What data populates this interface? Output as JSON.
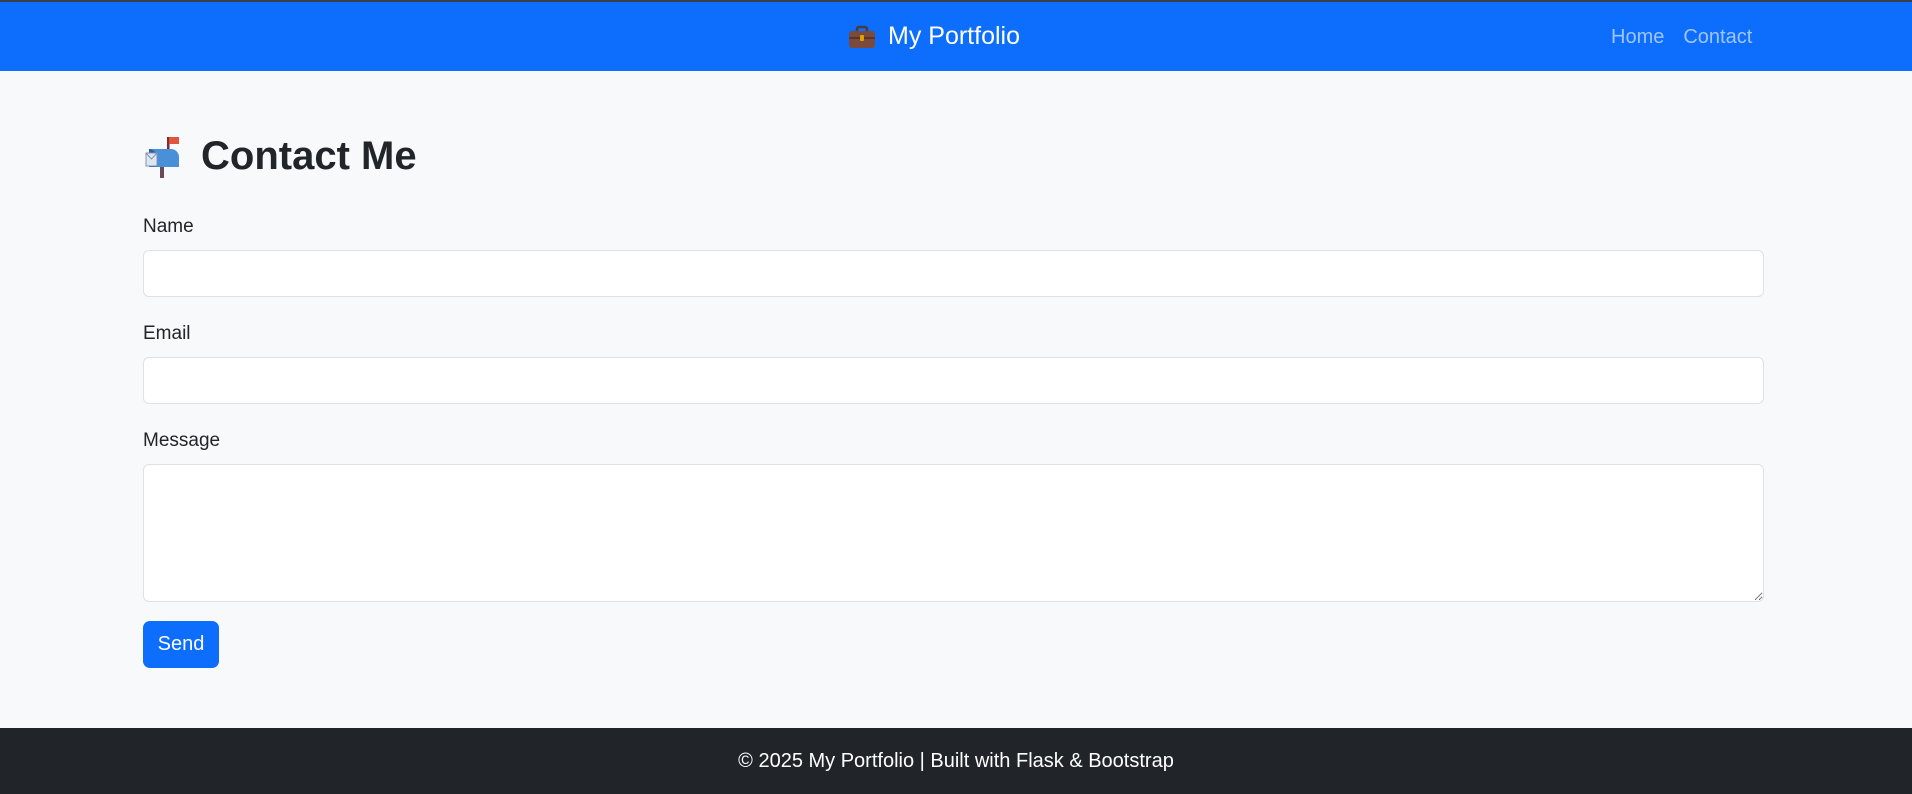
{
  "navbar": {
    "brand_icon": "briefcase-icon",
    "brand": "My Portfolio",
    "links": [
      {
        "label": "Home"
      },
      {
        "label": "Contact"
      }
    ],
    "bg_color": "#0d6efd"
  },
  "page": {
    "title_icon": "mailbox-icon",
    "title": "Contact Me"
  },
  "form": {
    "name": {
      "label": "Name",
      "value": ""
    },
    "email": {
      "label": "Email",
      "value": ""
    },
    "message": {
      "label": "Message",
      "value": ""
    },
    "submit_label": "Send"
  },
  "footer": {
    "text": "© 2025 My Portfolio | Built with Flask & Bootstrap"
  }
}
